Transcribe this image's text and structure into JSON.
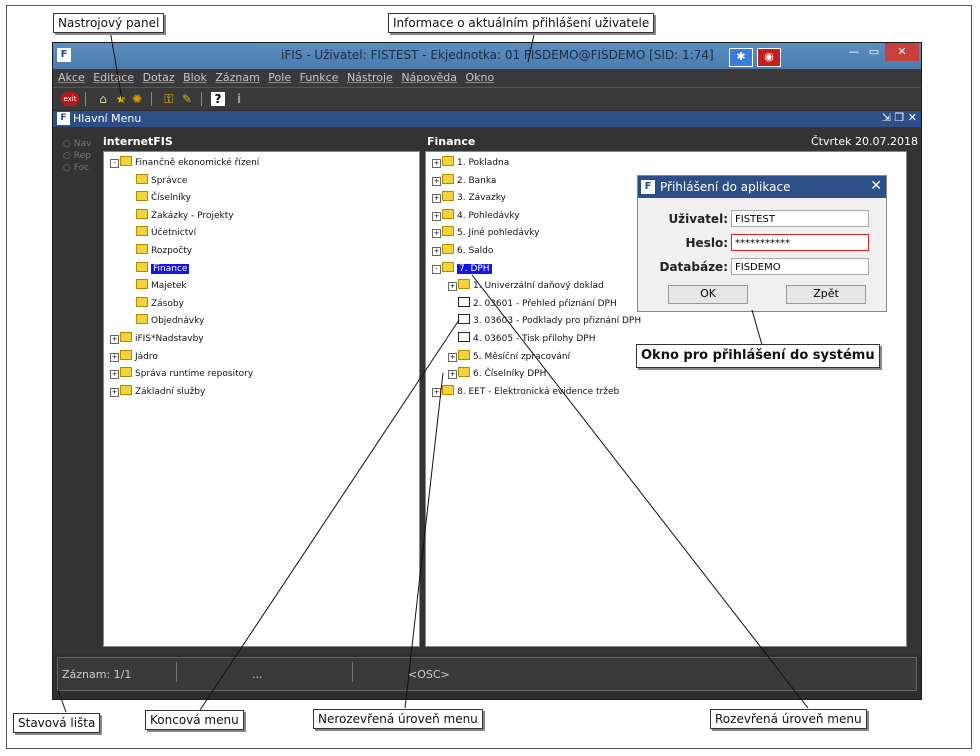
{
  "annotations": {
    "toolbar": "Nastrojový panel",
    "login_info": "Informace o aktuálním přihlášení uživatele",
    "login_window": "Okno pro přihlášení do systému",
    "statusbar": "Stavová lišta",
    "leaf_menu": "Koncová menu",
    "collapsed": "Nerozevřená úroveň menu",
    "expanded": "Rozevřená úroveň menu"
  },
  "app": {
    "title": "iFIS - Uživatel: FISTEST - Ekjednotka: 01 FISDEMO@FISDEMO   [SID: 1:74]",
    "logo": "F",
    "controls": {
      "minimize": "—",
      "maximize": "▭",
      "close": "✕"
    }
  },
  "menubar": [
    "Akce",
    "Editace",
    "Dotaz",
    "Blok",
    "Záznam",
    "Pole",
    "Funkce",
    "Nástroje",
    "Nápověda",
    "Okno"
  ],
  "toolbar_icons": [
    "exit-icon",
    "home-icon",
    "star-icon",
    "sun-icon",
    "key-icon",
    "wand-icon",
    "help-icon",
    "info-icon"
  ],
  "main_window": {
    "title": "Hlavní Menu",
    "controls": "⇲ ❐ ✕"
  },
  "radios": [
    "Nav",
    "Rep",
    "Foc"
  ],
  "left": {
    "header": "internetFIS",
    "tree": [
      {
        "label": "Finančně ekonomické řízení",
        "level": 0,
        "icon": "folder-open",
        "pm": "-"
      },
      {
        "label": "Správce",
        "level": 1,
        "icon": "folder"
      },
      {
        "label": "Číselníky",
        "level": 1,
        "icon": "folder"
      },
      {
        "label": "Zakázky - Projekty",
        "level": 1,
        "icon": "folder"
      },
      {
        "label": "Účetnictví",
        "level": 1,
        "icon": "folder"
      },
      {
        "label": "Rozpočty",
        "level": 1,
        "icon": "folder"
      },
      {
        "label": "Finance",
        "level": 1,
        "icon": "folder",
        "selected": true
      },
      {
        "label": "Majetek",
        "level": 1,
        "icon": "folder"
      },
      {
        "label": "Zásoby",
        "level": 1,
        "icon": "folder"
      },
      {
        "label": "Objednávky",
        "level": 1,
        "icon": "folder"
      },
      {
        "label": "iFIS*Nadstavby",
        "level": 0,
        "icon": "folder",
        "pm": "+"
      },
      {
        "label": "Jádro",
        "level": 0,
        "icon": "folder",
        "pm": "+"
      },
      {
        "label": "Správa runtime repository",
        "level": 0,
        "icon": "folder",
        "pm": "+"
      },
      {
        "label": "Základní služby",
        "level": 0,
        "icon": "folder",
        "pm": "+"
      }
    ]
  },
  "right": {
    "header": "Finance",
    "date": "Čtvrtek 20.07.2018",
    "tree": [
      {
        "label": "1.  Pokladna",
        "level": 0,
        "icon": "folder",
        "pm": "+"
      },
      {
        "label": "2.  Banka",
        "level": 0,
        "icon": "folder",
        "pm": "+"
      },
      {
        "label": "3.  Závazky",
        "level": 0,
        "icon": "folder",
        "pm": "+"
      },
      {
        "label": "4.  Pohledávky",
        "level": 0,
        "icon": "folder",
        "pm": "+"
      },
      {
        "label": "5.  Jiné pohledávky",
        "level": 0,
        "icon": "folder",
        "pm": "+"
      },
      {
        "label": "6.  Saldo",
        "level": 0,
        "icon": "folder",
        "pm": "+"
      },
      {
        "label": "7.  DPH",
        "level": 0,
        "icon": "folder-open",
        "pm": "-",
        "selected": true
      },
      {
        "label": "1.  Univerzální daňový doklad",
        "level": 1,
        "icon": "folder",
        "pm": "+"
      },
      {
        "label": "2.  03601 - Přehled přiznání DPH",
        "level": 1,
        "icon": "doc"
      },
      {
        "label": "3.  03603 - Podklady pro přiznání DPH",
        "level": 1,
        "icon": "doc"
      },
      {
        "label": "4.  03605 - Tisk přílohy DPH",
        "level": 1,
        "icon": "doc"
      },
      {
        "label": "5.  Měsíční zpracování",
        "level": 1,
        "icon": "folder",
        "pm": "+"
      },
      {
        "label": "6.  Číselníky DPH",
        "level": 1,
        "icon": "folder",
        "pm": "+"
      },
      {
        "label": "8.  EET - Elektronická evidence tržeb",
        "level": 0,
        "icon": "folder",
        "pm": "+"
      }
    ]
  },
  "statusbar": {
    "record": "Záznam: 1/1",
    "dots": "...",
    "osc": "<OSC>"
  },
  "login": {
    "title": "Přihlášení do aplikace",
    "user_label": "Uživatel:",
    "user_value": "FISTEST",
    "pass_label": "Heslo:",
    "pass_value": "***********",
    "db_label": "Databáze:",
    "db_value": "FISDEMO",
    "ok": "OK",
    "back": "Zpět"
  },
  "colors": {
    "selection": "#1515e8",
    "error_border": "#e02020"
  }
}
